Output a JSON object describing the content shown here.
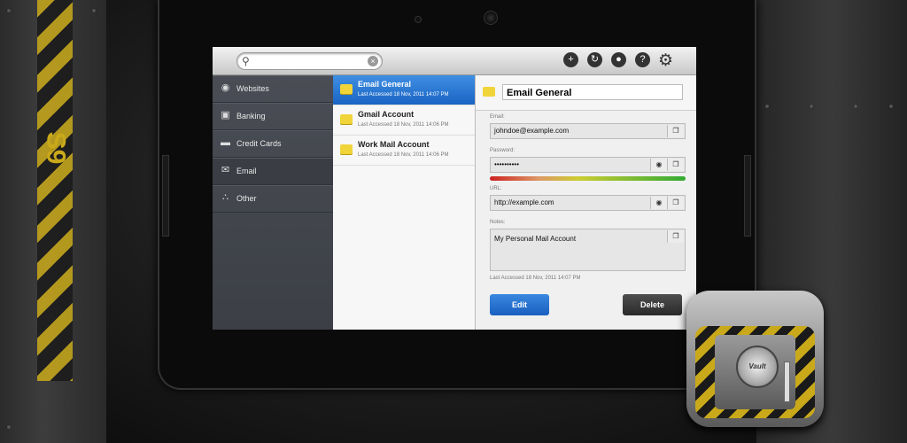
{
  "brand": {
    "logo_text": "S9"
  },
  "toolbar": {
    "search_placeholder": "",
    "icons": [
      "add-icon",
      "sync-icon",
      "lock-icon",
      "help-icon",
      "settings-icon"
    ]
  },
  "categories": [
    {
      "label": "Websites",
      "icon": "globe-icon",
      "selected": false
    },
    {
      "label": "Banking",
      "icon": "safe-icon",
      "selected": false
    },
    {
      "label": "Credit Cards",
      "icon": "credit-card-icon",
      "selected": false
    },
    {
      "label": "Email",
      "icon": "envelope-icon",
      "selected": true
    },
    {
      "label": "Other",
      "icon": "dots-icon",
      "selected": false
    }
  ],
  "entries": [
    {
      "name": "Email General",
      "accessed": "Last Accessed 18 Nov, 2011 14:07 PM",
      "selected": true
    },
    {
      "name": "Gmail Account",
      "accessed": "Last Accessed 18 Nov, 2011 14:06 PM",
      "selected": false
    },
    {
      "name": "Work Mail Account",
      "accessed": "Last Accessed 18 Nov, 2011 14:06 PM",
      "selected": false
    }
  ],
  "detail": {
    "title": "Email General",
    "email_label": "Email:",
    "email_value": "johndoe@example.com",
    "password_label": "Password:",
    "password_value": "••••••••••",
    "url_label": "URL:",
    "url_value": "http://example.com",
    "notes_label": "Notes:",
    "notes_value": "My Personal Mail Account",
    "last_accessed": "Last Accessed 18 Nov, 2011 14:07 PM",
    "edit_label": "Edit",
    "delete_label": "Delete"
  },
  "app_icon": {
    "dial_text": "Vault"
  },
  "colors": {
    "accent_blue": "#1a64c4",
    "hazard_yellow": "#c9a91a"
  }
}
